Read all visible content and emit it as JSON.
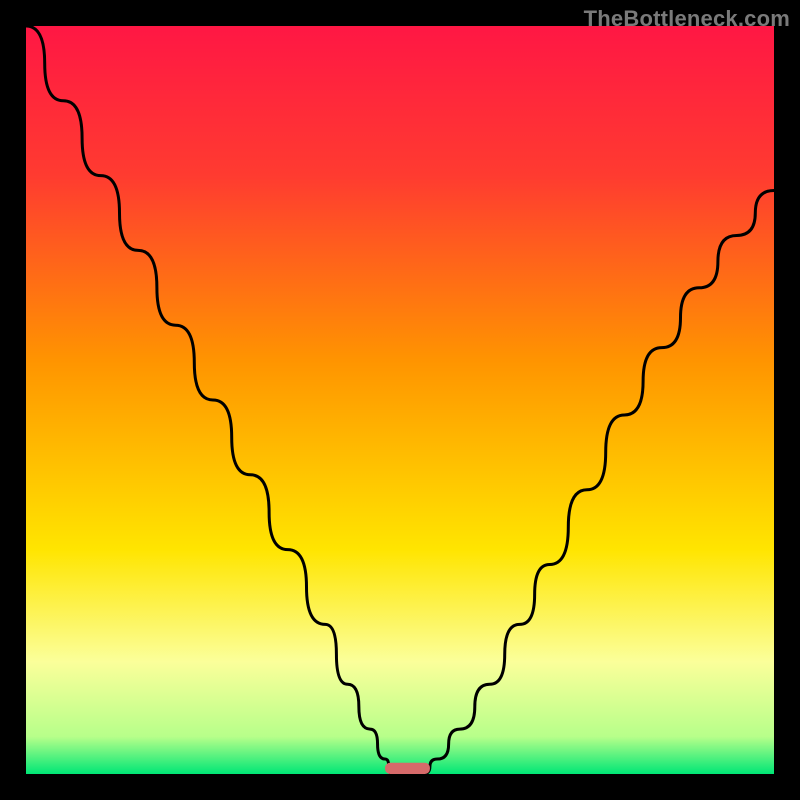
{
  "watermark": {
    "text": "TheBottleneck.com"
  },
  "chart_data": {
    "type": "line",
    "title": "",
    "xlabel": "",
    "ylabel": "",
    "xlim": [
      0,
      100
    ],
    "ylim": [
      0,
      100
    ],
    "grid": false,
    "legend": false,
    "gradient_stops": [
      {
        "offset": 0.0,
        "color": "#ff1744"
      },
      {
        "offset": 0.2,
        "color": "#ff3b30"
      },
      {
        "offset": 0.45,
        "color": "#ff9500"
      },
      {
        "offset": 0.7,
        "color": "#ffe500"
      },
      {
        "offset": 0.85,
        "color": "#fbff9a"
      },
      {
        "offset": 0.95,
        "color": "#b7ff8a"
      },
      {
        "offset": 1.0,
        "color": "#00e676"
      }
    ],
    "series": [
      {
        "name": "left-curve",
        "x": [
          0,
          5,
          10,
          15,
          20,
          25,
          30,
          35,
          40,
          43,
          46,
          48,
          49
        ],
        "y": [
          100,
          90,
          80,
          70,
          60,
          50,
          40,
          30,
          20,
          12,
          6,
          2,
          0
        ]
      },
      {
        "name": "right-curve",
        "x": [
          53,
          55,
          58,
          62,
          66,
          70,
          75,
          80,
          85,
          90,
          95,
          100
        ],
        "y": [
          0,
          2,
          6,
          12,
          20,
          28,
          38,
          48,
          57,
          65,
          72,
          78
        ]
      }
    ],
    "marker": {
      "x": 51,
      "y": 0,
      "width": 6,
      "height": 1.5
    }
  }
}
